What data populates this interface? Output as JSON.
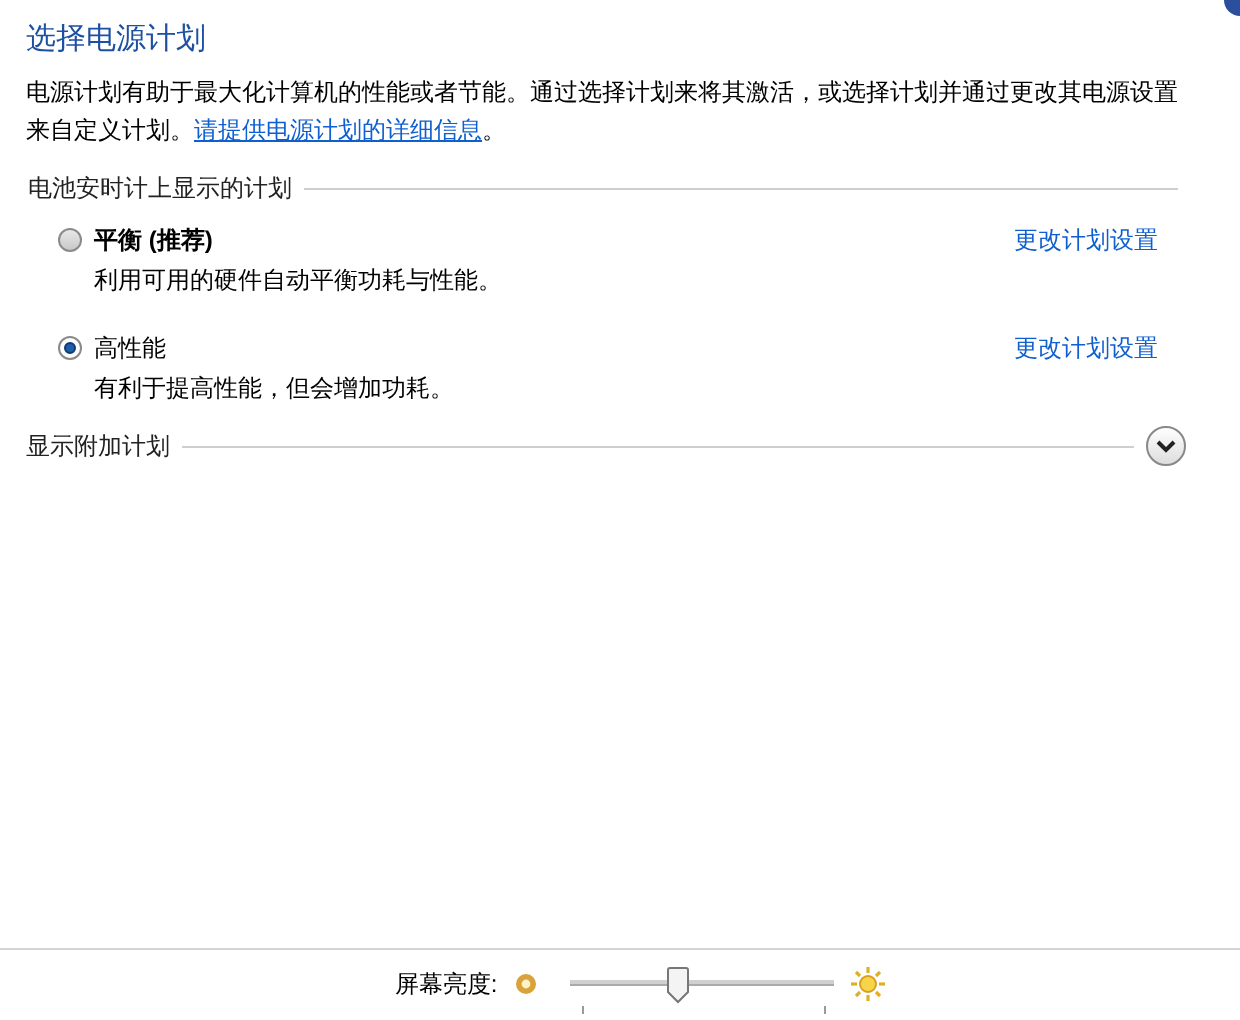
{
  "title": "选择电源计划",
  "intro": "电源计划有助于最大化计算机的性能或者节能。通过选择计划来将其激活，或选择计划并通过更改其电源设置来自定义计划。",
  "intro_link": "请提供电源计划的详细信息",
  "intro_end": "。",
  "section": "电池安时计上显示的计划",
  "plans": [
    {
      "name": "平衡 (推荐)",
      "description": "利用可用的硬件自动平衡功耗与性能。",
      "link": "更改计划设置",
      "selected": false
    },
    {
      "name": "高性能",
      "description": "有利于提高性能，但会增加功耗。",
      "link": "更改计划设置",
      "selected": true
    }
  ],
  "more_plans": {
    "label": "显示附加计划",
    "expanded": false
  },
  "brightness": {
    "label": "屏幕亮度:",
    "level": 0.4
  }
}
